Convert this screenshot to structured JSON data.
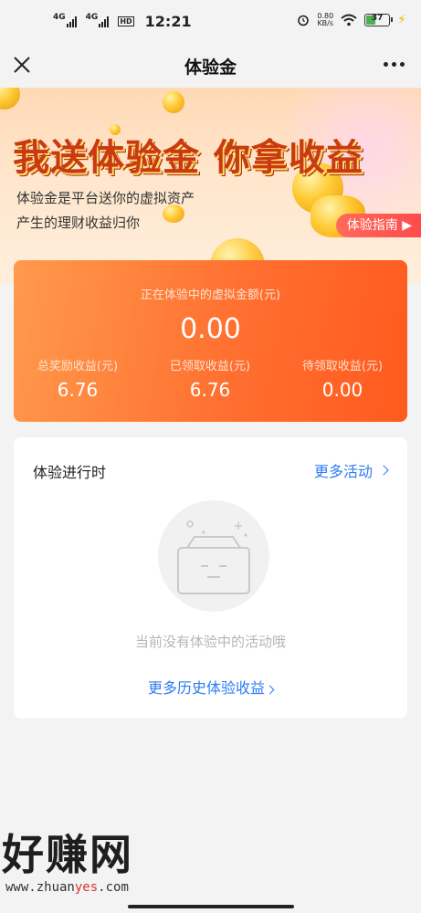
{
  "status_bar": {
    "net1": "4G",
    "net2": "4G",
    "hd": "HD",
    "time": "12:21",
    "speed_value": "0.80",
    "speed_unit": "KB/s",
    "battery": "37"
  },
  "navbar": {
    "title": "体验金",
    "close_icon": "close-icon",
    "more_icon": "more-dots-icon"
  },
  "banner": {
    "headline": "我送体验金  你拿收益",
    "subtitle_line1": "体验金是平台送你的虚拟资产",
    "subtitle_line2": "产生的理财收益归你",
    "guide_button": "体验指南 ▶"
  },
  "summary": {
    "label": "正在体验中的虚拟金额(元)",
    "amount": "0.00",
    "stats": [
      {
        "label": "总奖励收益(元)",
        "value": "6.76"
      },
      {
        "label": "已领取收益(元)",
        "value": "6.76"
      },
      {
        "label": "待领取收益(元)",
        "value": "0.00"
      }
    ]
  },
  "activity": {
    "title": "体验进行时",
    "more_link": "更多活动",
    "empty_text": "当前没有体验中的活动哦",
    "history_link": "更多历史体验收益"
  },
  "watermark": {
    "title": "好赚网",
    "url_prefix": "www.zhuan",
    "url_highlight": "yes",
    "url_suffix": ".com"
  },
  "colors": {
    "accent_blue": "#2d7cf0",
    "card_orange": "#ff7030",
    "headline_red": "#c93a12"
  }
}
